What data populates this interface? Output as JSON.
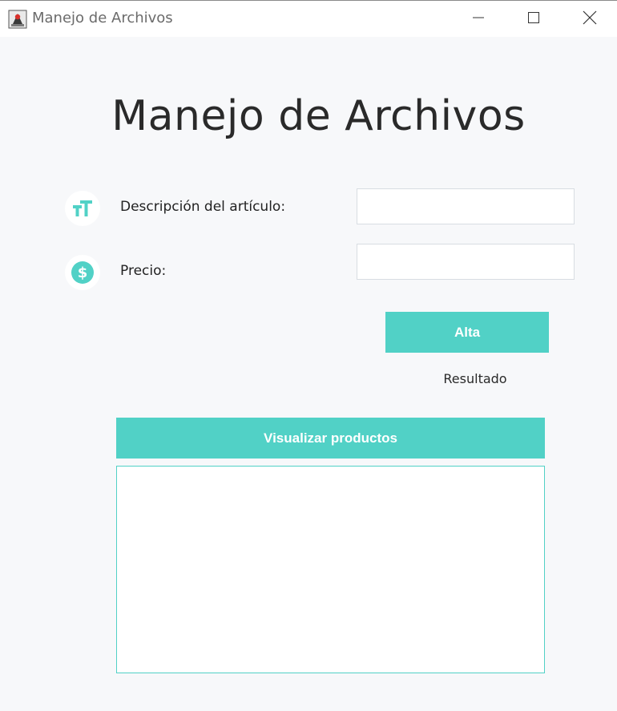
{
  "window": {
    "title": "Manejo de Archivos",
    "controls": {
      "minimize": "minimize-icon",
      "maximize": "maximize-icon",
      "close": "close-icon"
    }
  },
  "main": {
    "heading": "Manejo de Archivos",
    "fields": {
      "description": {
        "label": "Descripción del artículo:",
        "value": "",
        "icon": "text-size-icon"
      },
      "price": {
        "label": "Precio:",
        "value": "",
        "icon": "dollar-coin-icon"
      }
    },
    "alta_button": "Alta",
    "result_label": "Resultado",
    "view_button": "Visualizar productos",
    "output_text": ""
  },
  "colors": {
    "accent": "#51d1c6",
    "background": "#f7f8fa",
    "titlebar": "#ffffff",
    "text": "#2a2a2a"
  }
}
